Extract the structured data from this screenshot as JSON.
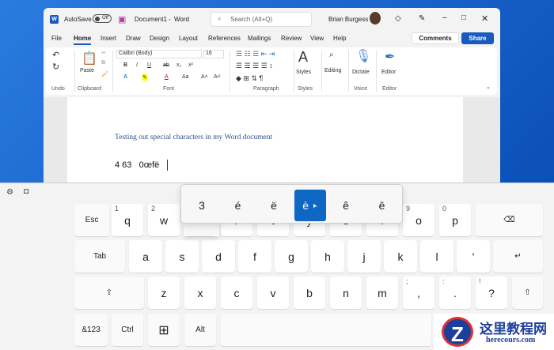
{
  "titlebar": {
    "autosave": "AutoSave",
    "toggle": "Off",
    "doc": "Document1",
    "sep": "-",
    "app": "Word",
    "search": "Search (Alt+Q)",
    "user": "Brian Burgess"
  },
  "tabs": [
    "File",
    "Home",
    "Insert",
    "Draw",
    "Design",
    "Layout",
    "References",
    "Mailings",
    "Review",
    "View",
    "Help"
  ],
  "comments": "Comments",
  "share": "Share",
  "ribbon": {
    "font": "Calibri (Body)",
    "size": "16",
    "paste": "Paste",
    "styles": "Styles",
    "editing": "Editing",
    "dictate": "Dictate",
    "editor": "Editor",
    "groups": [
      "Undo",
      "Clipboard",
      "Font",
      "Paragraph",
      "Styles",
      "Voice",
      "Editor"
    ],
    "fmt": [
      "B",
      "I",
      "U",
      "ab",
      "x₂",
      "x²",
      "A",
      "A",
      "Aa",
      "A˄",
      "A˅"
    ]
  },
  "document": {
    "line1": "Testing out special characters in my Word document",
    "line2": "4 63   0œfë"
  },
  "keyboard": {
    "rows": [
      [
        {
          "l": "Esc"
        },
        {
          "l": "q",
          "n": "1"
        },
        {
          "l": "w",
          "n": "2"
        },
        {
          "l": "e"
        },
        {
          "l": "r"
        },
        {
          "l": "t"
        },
        {
          "l": "y"
        },
        {
          "l": "u"
        },
        {
          "l": "i"
        },
        {
          "l": "o",
          "n": "9"
        },
        {
          "l": "p",
          "n": "0"
        },
        {
          "l": "⌫"
        }
      ],
      [
        {
          "l": "Tab"
        },
        {
          "l": "a"
        },
        {
          "l": "s"
        },
        {
          "l": "d"
        },
        {
          "l": "f"
        },
        {
          "l": "g"
        },
        {
          "l": "h"
        },
        {
          "l": "j"
        },
        {
          "l": "k"
        },
        {
          "l": "l"
        },
        {
          "l": "'"
        },
        {
          "l": "↵"
        }
      ],
      [
        {
          "l": "⇧"
        },
        {
          "l": "z"
        },
        {
          "l": "x"
        },
        {
          "l": "c"
        },
        {
          "l": "v"
        },
        {
          "l": "b"
        },
        {
          "l": "n"
        },
        {
          "l": "m"
        },
        {
          "l": ",",
          "n": ";"
        },
        {
          "l": ".",
          "n": ":"
        },
        {
          "l": "?",
          "n": "!"
        },
        {
          "l": "⇧"
        }
      ],
      [
        {
          "l": "&123"
        },
        {
          "l": "Ctrl"
        },
        {
          "l": "⊞"
        },
        {
          "l": "Alt"
        },
        {
          "l": ""
        }
      ]
    ],
    "alternates": [
      "3",
      "é",
      "ë",
      "è",
      "ê",
      "ē"
    ],
    "selected": 3
  },
  "watermark": {
    "title": "这里教程网",
    "url": "herecours.com"
  }
}
